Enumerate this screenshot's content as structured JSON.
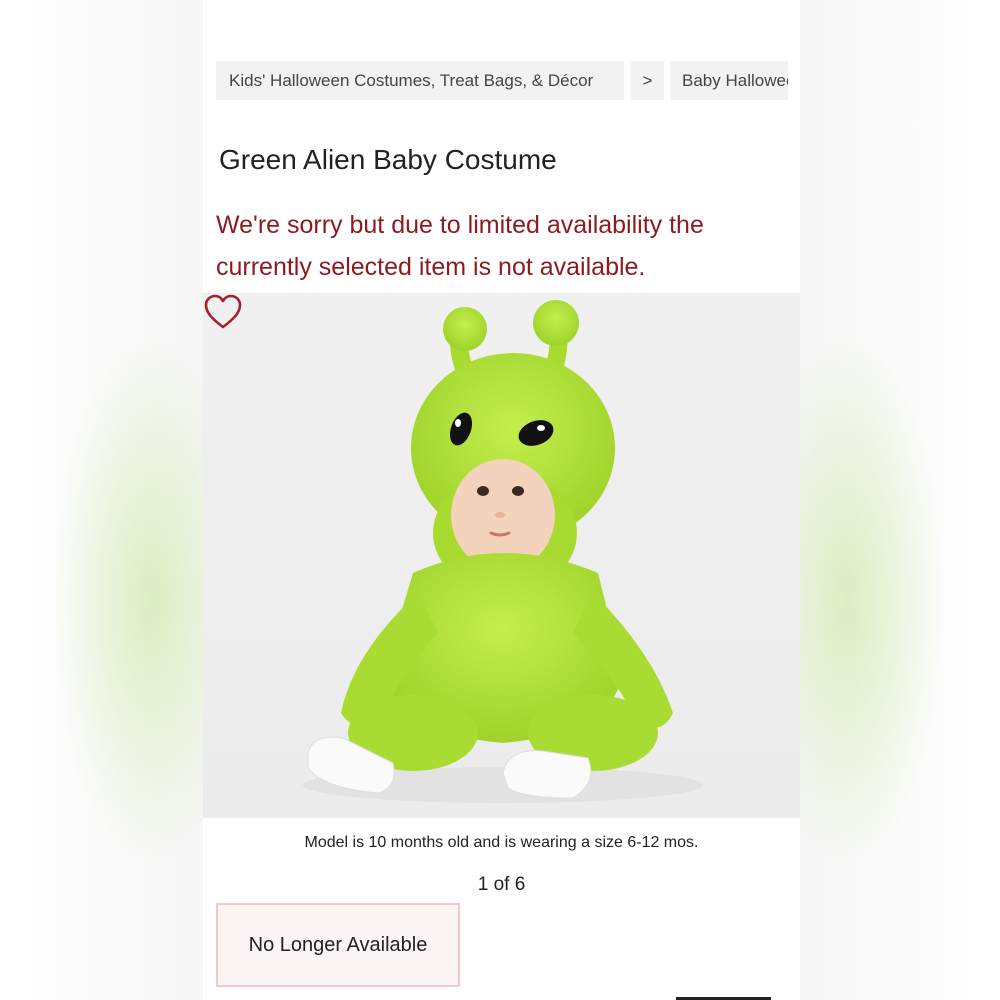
{
  "breadcrumb": {
    "items": [
      "Kids' Halloween Costumes, Treat Bags, & Décor",
      "Baby Halloween Costumes"
    ],
    "separator": ">"
  },
  "product": {
    "title": "Green Alien Baby Costume",
    "availability_notice": "We're sorry but due to limited availability the currently selected item is not available.",
    "image": {
      "caption": "Model is 10 months old and is wearing a size 6-12 mos.",
      "counter": "1 of 6"
    },
    "status_button": "No Longer Available"
  },
  "icons": {
    "favorite": "heart-outline-icon"
  },
  "colors": {
    "alert_text": "#8e1a1e",
    "favorite_icon": "#a3202a",
    "status_border": "#f3c8c8",
    "status_background": "#fdf4f4",
    "costume_green": "#b5e43a"
  }
}
